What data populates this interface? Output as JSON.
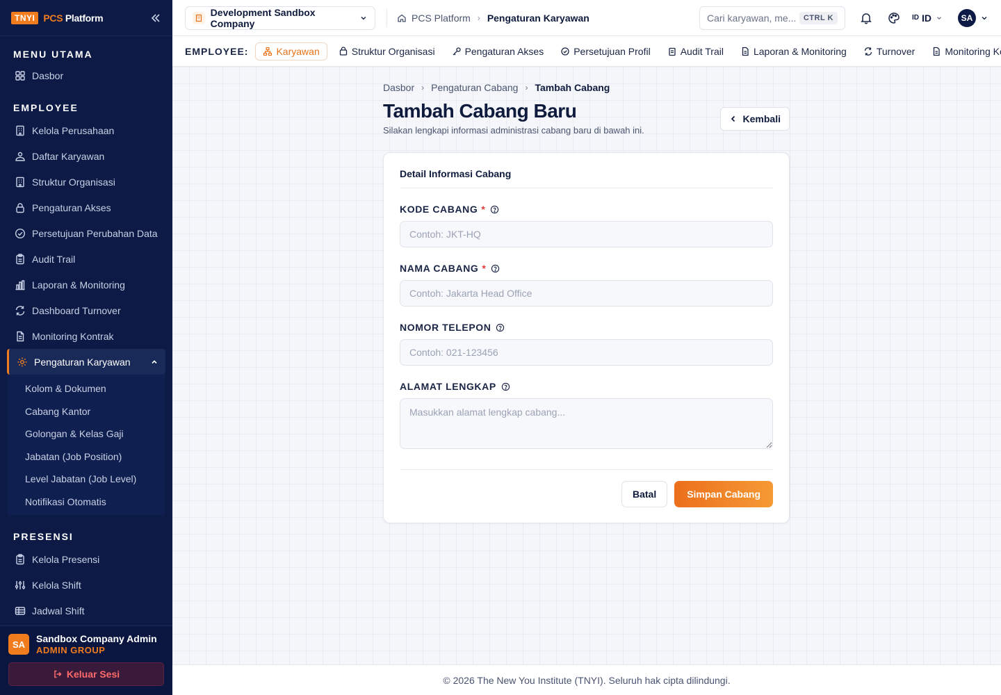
{
  "brand": {
    "logo": "TNYI",
    "name_a": "P",
    "name_b": "CS",
    "name_c": " Platform"
  },
  "sidebar": {
    "sections": [
      {
        "title": "MENU UTAMA"
      },
      {
        "title": "EMPLOYEE"
      },
      {
        "title": "PRESENSI"
      }
    ],
    "main_items": [
      {
        "label": "Dasbor",
        "icon": "grid-icon"
      }
    ],
    "employee_items": [
      {
        "label": "Kelola Perusahaan",
        "icon": "building-icon"
      },
      {
        "label": "Daftar Karyawan",
        "icon": "users-icon"
      },
      {
        "label": "Struktur Organisasi",
        "icon": "building-icon"
      },
      {
        "label": "Pengaturan Akses",
        "icon": "lock-icon"
      },
      {
        "label": "Persetujuan Perubahan Data",
        "icon": "check-circle-icon"
      },
      {
        "label": "Audit Trail",
        "icon": "clipboard-icon"
      },
      {
        "label": "Laporan & Monitoring",
        "icon": "chart-icon"
      },
      {
        "label": "Dashboard Turnover",
        "icon": "refresh-icon"
      },
      {
        "label": "Monitoring Kontrak",
        "icon": "file-icon"
      }
    ],
    "active_item": {
      "label": "Pengaturan Karyawan",
      "icon": "gear-icon"
    },
    "sub_items": [
      "Kolom & Dokumen",
      "Cabang Kantor",
      "Golongan & Kelas Gaji",
      "Jabatan (Job Position)",
      "Level Jabatan (Job Level)",
      "Notifikasi Otomatis"
    ],
    "presensi_items": [
      {
        "label": "Kelola Presensi",
        "icon": "clipboard-icon"
      },
      {
        "label": "Kelola Shift",
        "icon": "sliders-icon"
      },
      {
        "label": "Jadwal Shift",
        "icon": "table-icon"
      }
    ],
    "user": {
      "initials": "SA",
      "name": "Sandbox Company Admin",
      "role": "ADMIN GROUP"
    },
    "logout_label": "Keluar Sesi"
  },
  "topbar": {
    "company": "Development Sandbox Company",
    "crumb_root": "PCS Platform",
    "crumb_current": "Pengaturan Karyawan",
    "search_placeholder": "Cari karyawan, me...",
    "shortcut": "CTRL K",
    "lang_flag": "ID",
    "lang": "ID",
    "avatar": "SA"
  },
  "tabbar": {
    "label": "EMPLOYEE:",
    "tabs": [
      {
        "label": "Karyawan",
        "icon": "org-icon"
      },
      {
        "label": "Struktur Organisasi",
        "icon": "building-icon"
      },
      {
        "label": "Pengaturan Akses",
        "icon": "key-icon"
      },
      {
        "label": "Persetujuan Profil",
        "icon": "check-circle-icon"
      },
      {
        "label": "Audit Trail",
        "icon": "clipboard-icon"
      },
      {
        "label": "Laporan & Monitoring",
        "icon": "file-icon"
      },
      {
        "label": "Turnover",
        "icon": "refresh-icon"
      },
      {
        "label": "Monitoring Kontrak",
        "icon": "file-icon"
      }
    ]
  },
  "page": {
    "breadcrumb": [
      "Dasbor",
      "Pengaturan Cabang",
      "Tambah Cabang"
    ],
    "title": "Tambah Cabang Baru",
    "subtitle": "Silakan lengkapi informasi administrasi cabang baru di bawah ini.",
    "back_label": "Kembali"
  },
  "form": {
    "card_title": "Detail Informasi Cabang",
    "code_label": "KODE CABANG",
    "code_placeholder": "Contoh: JKT-HQ",
    "name_label": "NAMA CABANG",
    "name_placeholder": "Contoh: Jakarta Head Office",
    "phone_label": "NOMOR TELEPON",
    "phone_placeholder": "Contoh: 021-123456",
    "address_label": "ALAMAT LENGKAP",
    "address_placeholder": "Masukkan alamat lengkap cabang...",
    "required_mark": "*",
    "cancel_label": "Batal",
    "save_label": "Simpan Cabang"
  },
  "footer": {
    "text": "© 2026 The New You Institute (TNYI). Seluruh hak cipta dilindungi."
  },
  "colors": {
    "accent": "#f07c1e",
    "sidebar_bg": "#0c1a45",
    "danger": "#e23b3b"
  }
}
